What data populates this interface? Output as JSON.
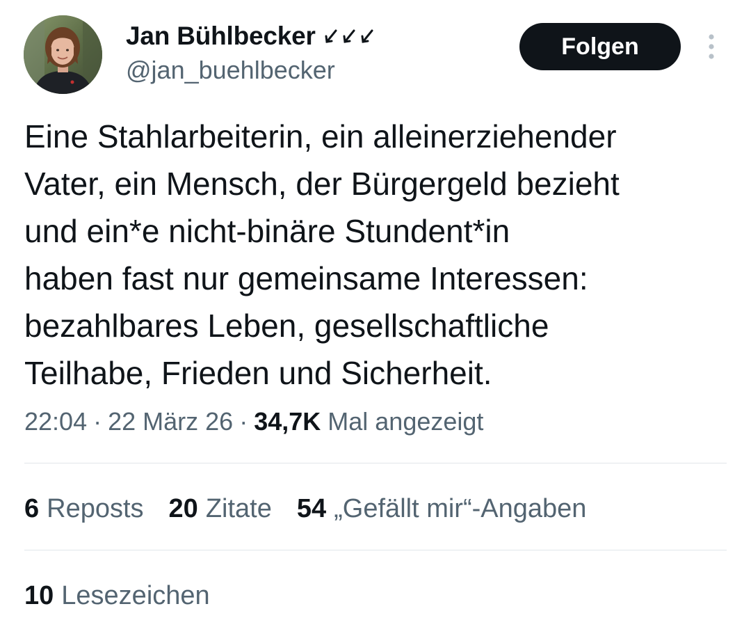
{
  "author": {
    "display_name": "Jan Bühlbecker",
    "handle": "@jan_buehlbecker",
    "name_marks": "↙↙↙"
  },
  "follow_button_label": "Folgen",
  "tweet": {
    "lines": [
      "Eine Stahlarbeiterin, ein alleinerziehender",
      "Vater, ein Mensch, der Bürgergeld bezieht",
      "und ein*e nicht-binäre Stundent*in",
      "haben fast nur gemeinsame Interessen:",
      "bezahlbares Leben, gesellschaftliche",
      "Teilhabe, Frieden und Sicherheit."
    ]
  },
  "meta": {
    "time": "22:04",
    "separator": "·",
    "date": "22 März 26",
    "views_count": "34,7K",
    "views_label": "Mal angezeigt"
  },
  "stats": {
    "reposts_count": "6",
    "reposts_label": "Reposts",
    "quotes_count": "20",
    "quotes_label": "Zitate",
    "likes_count": "54",
    "likes_label": "„Gefällt mir“-Angaben",
    "bookmarks_count": "10",
    "bookmarks_label": "Lesezeichen"
  },
  "colors": {
    "text_primary": "#0f1419",
    "text_secondary": "#536471",
    "divider": "#e1e6ea",
    "button_bg": "#0f1419"
  },
  "icons": {
    "more": "more-vertical-icon",
    "name_marks": "arrow-marks-icon"
  }
}
